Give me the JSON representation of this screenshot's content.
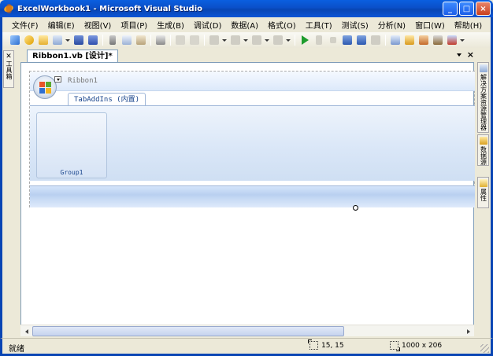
{
  "window": {
    "title": "ExcelWorkbook1 - Microsoft Visual Studio",
    "minimize": "_",
    "maximize": "□",
    "close": "×"
  },
  "menu": [
    {
      "label": "文件(F)"
    },
    {
      "label": "编辑(E)"
    },
    {
      "label": "视图(V)"
    },
    {
      "label": "项目(P)"
    },
    {
      "label": "生成(B)"
    },
    {
      "label": "调试(D)"
    },
    {
      "label": "数据(A)"
    },
    {
      "label": "格式(O)"
    },
    {
      "label": "工具(T)"
    },
    {
      "label": "测试(S)"
    },
    {
      "label": "分析(N)"
    },
    {
      "label": "窗口(W)"
    },
    {
      "label": "帮助(H)"
    }
  ],
  "toolbox_label": "工具箱",
  "document_tab": {
    "label": "Ribbon1.vb [设计]*"
  },
  "ribbon": {
    "name": "Ribbon1",
    "tab_label": "TabAddIns (内置)",
    "group_label": "Group1"
  },
  "right_panels": [
    {
      "label": "解决方案资源管理器"
    },
    {
      "label": "数据源"
    },
    {
      "label": "属性"
    }
  ],
  "status": {
    "text": "就绪",
    "position": "15, 15",
    "size": "1000 x 206"
  },
  "colors": {
    "accent": "#0845b4",
    "ribbon_text": "#15428b"
  }
}
